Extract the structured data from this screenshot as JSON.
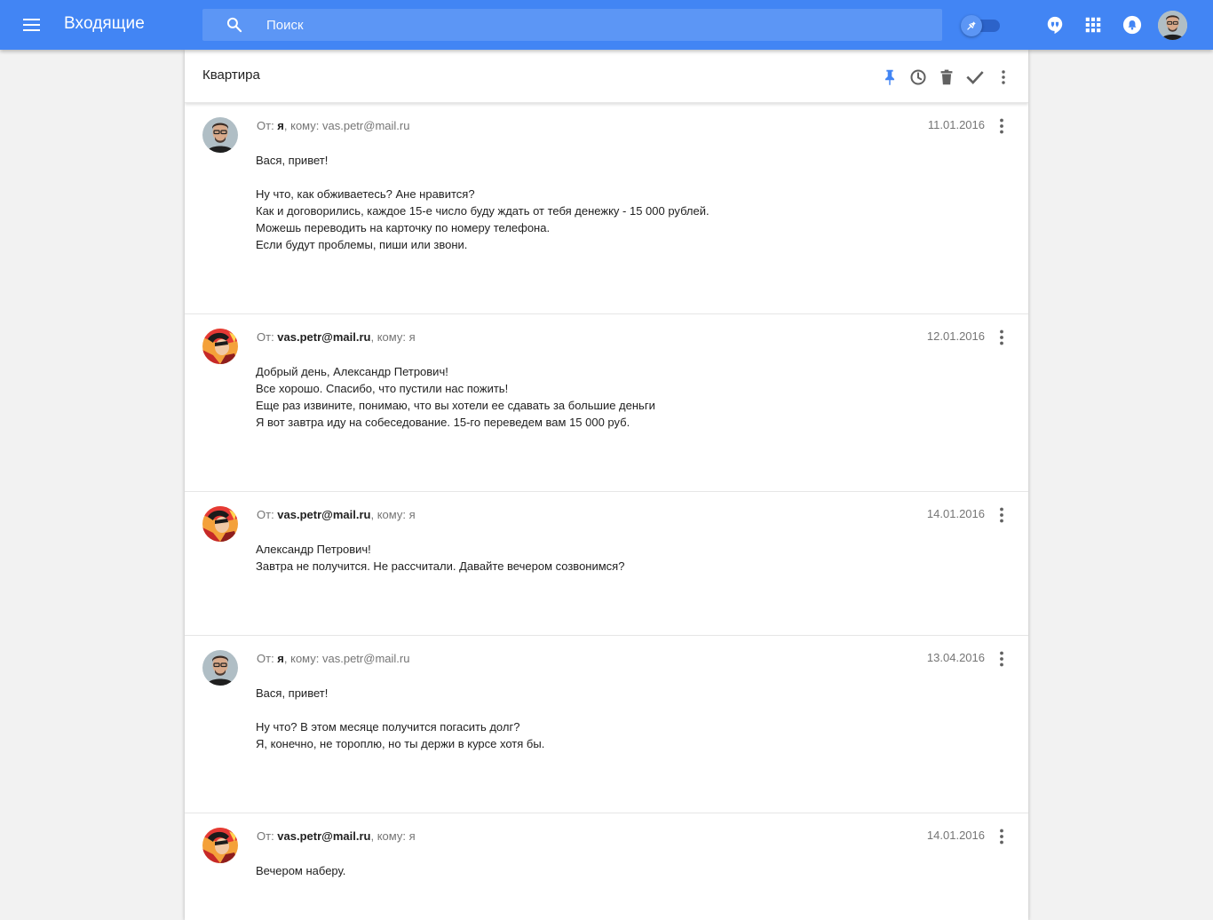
{
  "app": {
    "title": "Входящие",
    "search_placeholder": "Поиск",
    "accent_color": "#4285f4"
  },
  "icons": {
    "menu": "menu-icon",
    "search": "search-icon",
    "pin_toggle": "pin-icon",
    "hangouts": "hangouts-icon",
    "apps": "apps-grid-icon",
    "notifications": "bell-icon",
    "account": "avatar"
  },
  "thread": {
    "subject": "Квартира",
    "actions": [
      "pin-icon",
      "clock-icon",
      "trash-icon",
      "check-icon",
      "more-vert-icon"
    ],
    "messages": [
      {
        "from_label": "От: ",
        "from": "я",
        "to_label": ", кому: ",
        "to": "vas.petr@mail.ru",
        "date": "11.01.2016",
        "avatar": "me",
        "body": [
          "Вася, привет!",
          "",
          "Ну что, как обживаетесь? Ане нравится?",
          "Как и договорились, каждое 15-е число буду ждать от тебя денежку - 15 000 рублей.",
          "Можешь переводить на карточку по номеру телефона.",
          "Если будут проблемы, пиши или звони."
        ]
      },
      {
        "from_label": "От: ",
        "from": "vas.petr@mail.ru",
        "to_label": ", кому: ",
        "to": "я",
        "date": "12.01.2016",
        "avatar": "vas",
        "body": [
          "Добрый день, Александр Петрович!",
          "Все хорошо. Спасибо, что пустили нас пожить!",
          "Еще раз извините, понимаю, что вы хотели ее сдавать за большие деньги",
          "Я вот завтра иду на собеседование. 15-го переведем вам 15 000 руб."
        ]
      },
      {
        "from_label": "От: ",
        "from": "vas.petr@mail.ru",
        "to_label": ", кому: ",
        "to": "я",
        "date": "14.01.2016",
        "avatar": "vas",
        "body": [
          "Александр Петрович!",
          "Завтра не получится. Не рассчитали. Давайте вечером созвонимся?"
        ]
      },
      {
        "from_label": "От: ",
        "from": "я",
        "to_label": ", кому: ",
        "to": "vas.petr@mail.ru",
        "date": "13.04.2016",
        "avatar": "me",
        "body": [
          "Вася, привет!",
          "",
          "Ну что? В этом месяце получится погасить долг?",
          "Я, конечно, не тороплю, но ты держи в курсе хотя бы."
        ]
      },
      {
        "from_label": "От: ",
        "from": "vas.petr@mail.ru",
        "to_label": ", кому: ",
        "to": "я",
        "date": "14.01.2016",
        "avatar": "vas",
        "body": [
          "Вечером наберу."
        ]
      }
    ]
  }
}
